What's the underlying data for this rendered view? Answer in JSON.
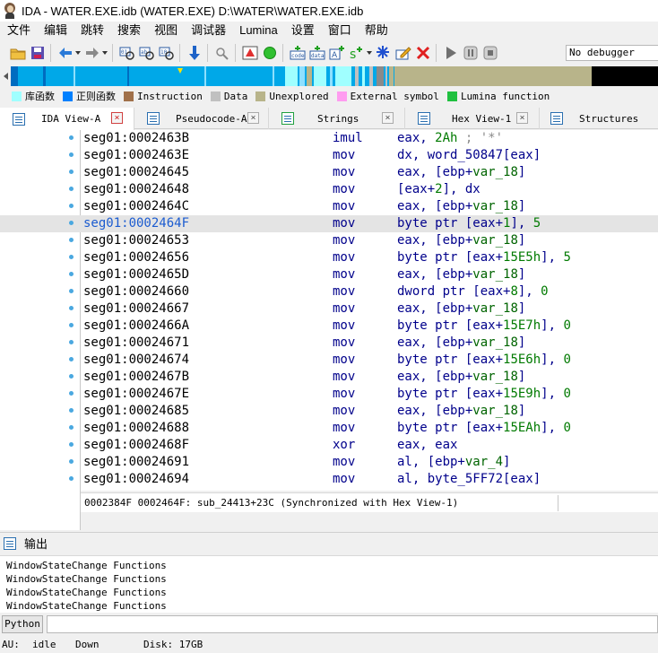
{
  "window": {
    "title": "IDA - WATER.EXE.idb (WATER.EXE) D:\\WATER\\WATER.EXE.idb"
  },
  "menu": [
    "文件",
    "编辑",
    "跳转",
    "搜索",
    "视图",
    "调试器",
    "Lumina",
    "设置",
    "窗口",
    "帮助"
  ],
  "toolbar": {
    "debugger": "No debugger"
  },
  "legend": [
    {
      "label": "库函数",
      "color": "#a0ffff"
    },
    {
      "label": "正则函数",
      "color": "#0080ff"
    },
    {
      "label": "Instruction",
      "color": "#a0704a"
    },
    {
      "label": "Data",
      "color": "#c0c0c0"
    },
    {
      "label": "Unexplored",
      "color": "#b8b48a"
    },
    {
      "label": "External symbol",
      "color": "#ff9cf0"
    },
    {
      "label": "Lumina function",
      "color": "#20c040"
    }
  ],
  "tabs": [
    {
      "label": "IDA View-A"
    },
    {
      "label": "Pseudocode-A"
    },
    {
      "label": "Strings"
    },
    {
      "label": "Hex View-1"
    },
    {
      "label": "Structures"
    }
  ],
  "listing": [
    {
      "addr": "seg01:0002463B",
      "mn": "imul",
      "ops": [
        [
          "eax, ",
          ""
        ],
        [
          "2Ah",
          "num"
        ],
        [
          " ; '*'",
          "cmt"
        ]
      ]
    },
    {
      "addr": "seg01:0002463E",
      "mn": "mov",
      "ops": [
        [
          "dx, word_50847[eax]",
          ""
        ]
      ]
    },
    {
      "addr": "seg01:00024645",
      "mn": "mov",
      "ops": [
        [
          "eax, [ebp+",
          ""
        ],
        [
          "var_18",
          "var"
        ],
        [
          "]",
          ""
        ]
      ]
    },
    {
      "addr": "seg01:00024648",
      "mn": "mov",
      "ops": [
        [
          "[eax+",
          ""
        ],
        [
          "2",
          "num"
        ],
        [
          "], dx",
          ""
        ]
      ]
    },
    {
      "addr": "seg01:0002464C",
      "mn": "mov",
      "ops": [
        [
          "eax, [ebp+",
          ""
        ],
        [
          "var_18",
          "var"
        ],
        [
          "]",
          ""
        ]
      ]
    },
    {
      "addr": "seg01:0002464F",
      "mn": "mov",
      "ops": [
        [
          "byte ptr [eax+",
          ""
        ],
        [
          "1",
          "num"
        ],
        [
          "], ",
          ""
        ],
        [
          "5",
          "num"
        ]
      ]
    },
    {
      "addr": "seg01:00024653",
      "mn": "mov",
      "ops": [
        [
          "eax, [ebp+",
          ""
        ],
        [
          "var_18",
          "var"
        ],
        [
          "]",
          ""
        ]
      ]
    },
    {
      "addr": "seg01:00024656",
      "mn": "mov",
      "ops": [
        [
          "byte ptr [eax+",
          ""
        ],
        [
          "15E5h",
          "num"
        ],
        [
          "], ",
          ""
        ],
        [
          "5",
          "num"
        ]
      ]
    },
    {
      "addr": "seg01:0002465D",
      "mn": "mov",
      "ops": [
        [
          "eax, [ebp+",
          ""
        ],
        [
          "var_18",
          "var"
        ],
        [
          "]",
          ""
        ]
      ]
    },
    {
      "addr": "seg01:00024660",
      "mn": "mov",
      "ops": [
        [
          "dword ptr [eax+",
          ""
        ],
        [
          "8",
          "num"
        ],
        [
          "], ",
          ""
        ],
        [
          "0",
          "num"
        ]
      ]
    },
    {
      "addr": "seg01:00024667",
      "mn": "mov",
      "ops": [
        [
          "eax, [ebp+",
          ""
        ],
        [
          "var_18",
          "var"
        ],
        [
          "]",
          ""
        ]
      ]
    },
    {
      "addr": "seg01:0002466A",
      "mn": "mov",
      "ops": [
        [
          "byte ptr [eax+",
          ""
        ],
        [
          "15E7h",
          "num"
        ],
        [
          "], ",
          ""
        ],
        [
          "0",
          "num"
        ]
      ]
    },
    {
      "addr": "seg01:00024671",
      "mn": "mov",
      "ops": [
        [
          "eax, [ebp+",
          ""
        ],
        [
          "var_18",
          "var"
        ],
        [
          "]",
          ""
        ]
      ]
    },
    {
      "addr": "seg01:00024674",
      "mn": "mov",
      "ops": [
        [
          "byte ptr [eax+",
          ""
        ],
        [
          "15E6h",
          "num"
        ],
        [
          "], ",
          ""
        ],
        [
          "0",
          "num"
        ]
      ]
    },
    {
      "addr": "seg01:0002467B",
      "mn": "mov",
      "ops": [
        [
          "eax, [ebp+",
          ""
        ],
        [
          "var_18",
          "var"
        ],
        [
          "]",
          ""
        ]
      ]
    },
    {
      "addr": "seg01:0002467E",
      "mn": "mov",
      "ops": [
        [
          "byte ptr [eax+",
          ""
        ],
        [
          "15E9h",
          "num"
        ],
        [
          "], ",
          ""
        ],
        [
          "0",
          "num"
        ]
      ]
    },
    {
      "addr": "seg01:00024685",
      "mn": "mov",
      "ops": [
        [
          "eax, [ebp+",
          ""
        ],
        [
          "var_18",
          "var"
        ],
        [
          "]",
          ""
        ]
      ]
    },
    {
      "addr": "seg01:00024688",
      "mn": "mov",
      "ops": [
        [
          "byte ptr [eax+",
          ""
        ],
        [
          "15EAh",
          "num"
        ],
        [
          "], ",
          ""
        ],
        [
          "0",
          "num"
        ]
      ]
    },
    {
      "addr": "seg01:0002468F",
      "mn": "xor",
      "ops": [
        [
          "eax, eax",
          ""
        ]
      ]
    },
    {
      "addr": "seg01:00024691",
      "mn": "mov",
      "ops": [
        [
          "al, [ebp+",
          ""
        ],
        [
          "var_4",
          "var"
        ],
        [
          "]",
          ""
        ]
      ]
    },
    {
      "addr": "seg01:00024694",
      "mn": "mov",
      "ops": [
        [
          "al, byte_5FF72[eax]",
          ""
        ]
      ]
    }
  ],
  "highlighted_addr": "seg01:0002464F",
  "sync_status": "0002384F 0002464F: sub_24413+23C (Synchronized with Hex View-1)",
  "output": {
    "title": "输出",
    "lines": [
      "WindowStateChange Functions",
      "WindowStateChange Functions",
      "WindowStateChange Functions",
      "WindowStateChange Functions"
    ]
  },
  "cmd": {
    "lang": "Python"
  },
  "status": {
    "au_label": "AU:",
    "au_value": "idle",
    "direction": "Down",
    "disk": "Disk: 17GB"
  }
}
